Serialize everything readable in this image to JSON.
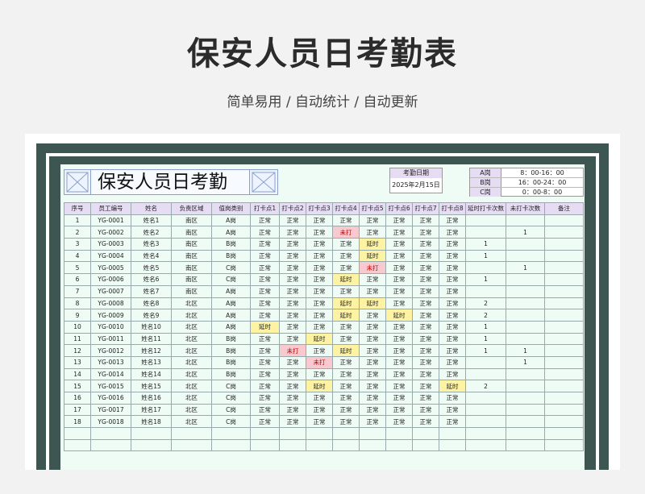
{
  "page": {
    "title": "保安人员日考勤表",
    "subtitle": "简单易用 / 自动统计 / 自动更新"
  },
  "sheet": {
    "title": "保安人员日考勤",
    "date_label": "考勤日期",
    "date_value": "2025年2月15日",
    "shifts": [
      {
        "name": "A岗",
        "time": "8：00-16：00"
      },
      {
        "name": "B岗",
        "time": "16：00-24：00"
      },
      {
        "name": "C岗",
        "time": "0：00-8：00"
      }
    ],
    "headers": [
      "序号",
      "员工编号",
      "姓名",
      "负责区域",
      "值岗类别",
      "打卡点1",
      "打卡点2",
      "打卡点3",
      "打卡点4",
      "打卡点5",
      "打卡点6",
      "打卡点7",
      "打卡点8",
      "延时打卡次数",
      "未打卡次数",
      "备注"
    ],
    "rows": [
      [
        "1",
        "YG-0001",
        "姓名1",
        "南区",
        "A岗",
        "正常",
        "正常",
        "正常",
        "正常",
        "正常",
        "正常",
        "正常",
        "正常",
        "",
        "",
        ""
      ],
      [
        "2",
        "YG-0002",
        "姓名2",
        "南区",
        "A岗",
        "正常",
        "正常",
        "正常",
        "未打",
        "正常",
        "正常",
        "正常",
        "正常",
        "",
        "1",
        ""
      ],
      [
        "3",
        "YG-0003",
        "姓名3",
        "南区",
        "B岗",
        "正常",
        "正常",
        "正常",
        "正常",
        "延时",
        "正常",
        "正常",
        "正常",
        "1",
        "",
        ""
      ],
      [
        "4",
        "YG-0004",
        "姓名4",
        "南区",
        "B岗",
        "正常",
        "正常",
        "正常",
        "正常",
        "延时",
        "正常",
        "正常",
        "正常",
        "1",
        "",
        ""
      ],
      [
        "5",
        "YG-0005",
        "姓名5",
        "南区",
        "C岗",
        "正常",
        "正常",
        "正常",
        "正常",
        "未打",
        "正常",
        "正常",
        "正常",
        "",
        "1",
        ""
      ],
      [
        "6",
        "YG-0006",
        "姓名6",
        "南区",
        "C岗",
        "正常",
        "正常",
        "正常",
        "延时",
        "正常",
        "正常",
        "正常",
        "正常",
        "1",
        "",
        ""
      ],
      [
        "7",
        "YG-0007",
        "姓名7",
        "南区",
        "A岗",
        "正常",
        "正常",
        "正常",
        "正常",
        "正常",
        "正常",
        "正常",
        "正常",
        "",
        "",
        ""
      ],
      [
        "8",
        "YG-0008",
        "姓名8",
        "北区",
        "A岗",
        "正常",
        "正常",
        "正常",
        "延时",
        "延时",
        "正常",
        "正常",
        "正常",
        "2",
        "",
        ""
      ],
      [
        "9",
        "YG-0009",
        "姓名9",
        "北区",
        "A岗",
        "正常",
        "正常",
        "正常",
        "延时",
        "正常",
        "延时",
        "正常",
        "正常",
        "2",
        "",
        ""
      ],
      [
        "10",
        "YG-0010",
        "姓名10",
        "北区",
        "A岗",
        "延时",
        "正常",
        "正常",
        "正常",
        "正常",
        "正常",
        "正常",
        "正常",
        "1",
        "",
        ""
      ],
      [
        "11",
        "YG-0011",
        "姓名11",
        "北区",
        "B岗",
        "正常",
        "正常",
        "延时",
        "正常",
        "正常",
        "正常",
        "正常",
        "正常",
        "1",
        "",
        ""
      ],
      [
        "12",
        "YG-0012",
        "姓名12",
        "北区",
        "B岗",
        "正常",
        "未打",
        "正常",
        "延时",
        "正常",
        "正常",
        "正常",
        "正常",
        "1",
        "1",
        ""
      ],
      [
        "13",
        "YG-0013",
        "姓名13",
        "北区",
        "B岗",
        "正常",
        "正常",
        "未打",
        "正常",
        "正常",
        "正常",
        "正常",
        "正常",
        "",
        "1",
        ""
      ],
      [
        "14",
        "YG-0014",
        "姓名14",
        "北区",
        "B岗",
        "正常",
        "正常",
        "正常",
        "正常",
        "正常",
        "正常",
        "正常",
        "正常",
        "",
        "",
        ""
      ],
      [
        "15",
        "YG-0015",
        "姓名15",
        "北区",
        "C岗",
        "正常",
        "正常",
        "延时",
        "正常",
        "正常",
        "正常",
        "正常",
        "延时",
        "2",
        "",
        ""
      ],
      [
        "16",
        "YG-0016",
        "姓名16",
        "北区",
        "C岗",
        "正常",
        "正常",
        "正常",
        "正常",
        "正常",
        "正常",
        "正常",
        "正常",
        "",
        "",
        ""
      ],
      [
        "17",
        "YG-0017",
        "姓名17",
        "北区",
        "C岗",
        "正常",
        "正常",
        "正常",
        "正常",
        "正常",
        "正常",
        "正常",
        "正常",
        "",
        "",
        ""
      ],
      [
        "18",
        "YG-0018",
        "姓名18",
        "北区",
        "C岗",
        "正常",
        "正常",
        "正常",
        "正常",
        "正常",
        "正常",
        "正常",
        "正常",
        "",
        "",
        ""
      ]
    ],
    "empty_rows": 2,
    "status_colors": {
      "late": "#fdf3a3",
      "missed": "#f8c9cf",
      "header": "#e6dcf4",
      "frame": "#3d5651",
      "sheet_bg": "#eefcf5"
    }
  }
}
